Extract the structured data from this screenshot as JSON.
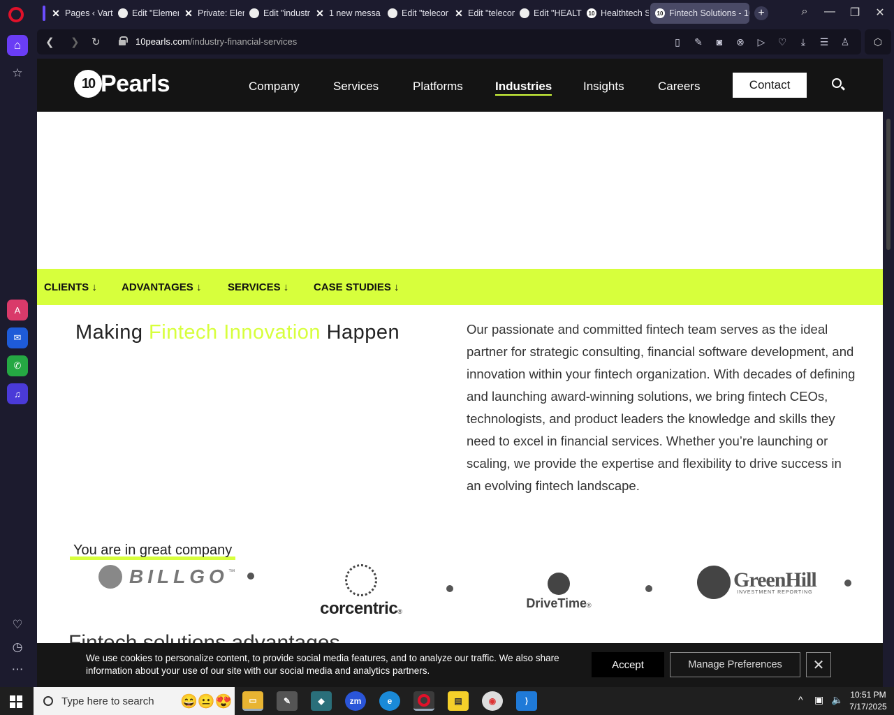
{
  "browser": {
    "tabs": [
      {
        "title": "Pages ‹ Varta",
        "icon": "x-icon"
      },
      {
        "title": "Edit \"Elemen",
        "icon": "globe-icon"
      },
      {
        "title": "Private: Elem",
        "icon": "x-icon"
      },
      {
        "title": "Edit \"industr",
        "icon": "globe-icon"
      },
      {
        "title": "1 new messa",
        "icon": "x-icon"
      },
      {
        "title": "Edit \"telecon",
        "icon": "globe-icon"
      },
      {
        "title": "Edit \"telecon",
        "icon": "x-icon"
      },
      {
        "title": "Edit \"HEALTI",
        "icon": "globe-icon"
      },
      {
        "title": "Healthtech S",
        "icon": "tenpearls-icon"
      },
      {
        "title": "Fintech Solutions - 10",
        "icon": "tenpearls-icon",
        "active": true
      }
    ],
    "url_domain": "10pearls.com",
    "url_path": "/industry-financial-services"
  },
  "site": {
    "logo_text": "Pearls",
    "logo_mark": "10",
    "menu": [
      "Company",
      "Services",
      "Platforms",
      "Industries",
      "Insights",
      "Careers"
    ],
    "active_menu": "Industries",
    "contact_label": "Contact",
    "subnav": [
      "CLIENTS ↓",
      "ADVANTAGES ↓",
      "SERVICES ↓",
      "CASE STUDIES ↓"
    ],
    "headline_pre": "Making ",
    "headline_hl": "Fintech Innovation",
    "headline_post": " Happen",
    "intro": "Our passionate and committed fintech team serves as the ideal partner for strategic consulting, financial software development, and innovation within your fintech organization. With decades of defining and launching award-winning solutions, we bring fintech CEOs, technologists, and product leaders the knowledge and skills they need to excel in financial services. Whether you’re launching or scaling, we provide the expertise and flexibility to drive success in an evolving fintech landscape.",
    "clients_heading": "You are in great company",
    "clients": {
      "billgo": "BILLGO",
      "billgo_tm": "™",
      "corcentric": "corcentric",
      "corcentric_tm": "®",
      "drivetime": "DriveTime",
      "drivetime_tm": "®",
      "greenhill": "GreenHill",
      "greenhill_sub": "INVESTMENT REPORTING"
    },
    "section2_heading": "Fintech solutions advantages",
    "accent_color": "#d7ff3c"
  },
  "cookie": {
    "text": "We use cookies to personalize content, to provide social media features, and to analyze our traffic. We also share information about your use of our site with our social media and analytics partners.",
    "accept": "Accept",
    "manage": "Manage Preferences"
  },
  "taskbar": {
    "search_placeholder": "Type here to search",
    "time": "10:51 PM",
    "date": "7/17/2025"
  }
}
